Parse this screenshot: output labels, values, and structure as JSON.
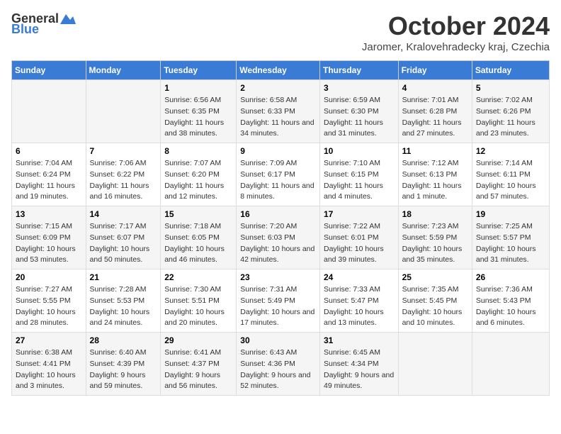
{
  "header": {
    "logo_general": "General",
    "logo_blue": "Blue",
    "month_title": "October 2024",
    "location": "Jaromer, Kralovehradecky kraj, Czechia"
  },
  "days_of_week": [
    "Sunday",
    "Monday",
    "Tuesday",
    "Wednesday",
    "Thursday",
    "Friday",
    "Saturday"
  ],
  "weeks": [
    [
      {
        "day": "",
        "info": ""
      },
      {
        "day": "",
        "info": ""
      },
      {
        "day": "1",
        "info": "Sunrise: 6:56 AM\nSunset: 6:35 PM\nDaylight: 11 hours and 38 minutes."
      },
      {
        "day": "2",
        "info": "Sunrise: 6:58 AM\nSunset: 6:33 PM\nDaylight: 11 hours and 34 minutes."
      },
      {
        "day": "3",
        "info": "Sunrise: 6:59 AM\nSunset: 6:30 PM\nDaylight: 11 hours and 31 minutes."
      },
      {
        "day": "4",
        "info": "Sunrise: 7:01 AM\nSunset: 6:28 PM\nDaylight: 11 hours and 27 minutes."
      },
      {
        "day": "5",
        "info": "Sunrise: 7:02 AM\nSunset: 6:26 PM\nDaylight: 11 hours and 23 minutes."
      }
    ],
    [
      {
        "day": "6",
        "info": "Sunrise: 7:04 AM\nSunset: 6:24 PM\nDaylight: 11 hours and 19 minutes."
      },
      {
        "day": "7",
        "info": "Sunrise: 7:06 AM\nSunset: 6:22 PM\nDaylight: 11 hours and 16 minutes."
      },
      {
        "day": "8",
        "info": "Sunrise: 7:07 AM\nSunset: 6:20 PM\nDaylight: 11 hours and 12 minutes."
      },
      {
        "day": "9",
        "info": "Sunrise: 7:09 AM\nSunset: 6:17 PM\nDaylight: 11 hours and 8 minutes."
      },
      {
        "day": "10",
        "info": "Sunrise: 7:10 AM\nSunset: 6:15 PM\nDaylight: 11 hours and 4 minutes."
      },
      {
        "day": "11",
        "info": "Sunrise: 7:12 AM\nSunset: 6:13 PM\nDaylight: 11 hours and 1 minute."
      },
      {
        "day": "12",
        "info": "Sunrise: 7:14 AM\nSunset: 6:11 PM\nDaylight: 10 hours and 57 minutes."
      }
    ],
    [
      {
        "day": "13",
        "info": "Sunrise: 7:15 AM\nSunset: 6:09 PM\nDaylight: 10 hours and 53 minutes."
      },
      {
        "day": "14",
        "info": "Sunrise: 7:17 AM\nSunset: 6:07 PM\nDaylight: 10 hours and 50 minutes."
      },
      {
        "day": "15",
        "info": "Sunrise: 7:18 AM\nSunset: 6:05 PM\nDaylight: 10 hours and 46 minutes."
      },
      {
        "day": "16",
        "info": "Sunrise: 7:20 AM\nSunset: 6:03 PM\nDaylight: 10 hours and 42 minutes."
      },
      {
        "day": "17",
        "info": "Sunrise: 7:22 AM\nSunset: 6:01 PM\nDaylight: 10 hours and 39 minutes."
      },
      {
        "day": "18",
        "info": "Sunrise: 7:23 AM\nSunset: 5:59 PM\nDaylight: 10 hours and 35 minutes."
      },
      {
        "day": "19",
        "info": "Sunrise: 7:25 AM\nSunset: 5:57 PM\nDaylight: 10 hours and 31 minutes."
      }
    ],
    [
      {
        "day": "20",
        "info": "Sunrise: 7:27 AM\nSunset: 5:55 PM\nDaylight: 10 hours and 28 minutes."
      },
      {
        "day": "21",
        "info": "Sunrise: 7:28 AM\nSunset: 5:53 PM\nDaylight: 10 hours and 24 minutes."
      },
      {
        "day": "22",
        "info": "Sunrise: 7:30 AM\nSunset: 5:51 PM\nDaylight: 10 hours and 20 minutes."
      },
      {
        "day": "23",
        "info": "Sunrise: 7:31 AM\nSunset: 5:49 PM\nDaylight: 10 hours and 17 minutes."
      },
      {
        "day": "24",
        "info": "Sunrise: 7:33 AM\nSunset: 5:47 PM\nDaylight: 10 hours and 13 minutes."
      },
      {
        "day": "25",
        "info": "Sunrise: 7:35 AM\nSunset: 5:45 PM\nDaylight: 10 hours and 10 minutes."
      },
      {
        "day": "26",
        "info": "Sunrise: 7:36 AM\nSunset: 5:43 PM\nDaylight: 10 hours and 6 minutes."
      }
    ],
    [
      {
        "day": "27",
        "info": "Sunrise: 6:38 AM\nSunset: 4:41 PM\nDaylight: 10 hours and 3 minutes."
      },
      {
        "day": "28",
        "info": "Sunrise: 6:40 AM\nSunset: 4:39 PM\nDaylight: 9 hours and 59 minutes."
      },
      {
        "day": "29",
        "info": "Sunrise: 6:41 AM\nSunset: 4:37 PM\nDaylight: 9 hours and 56 minutes."
      },
      {
        "day": "30",
        "info": "Sunrise: 6:43 AM\nSunset: 4:36 PM\nDaylight: 9 hours and 52 minutes."
      },
      {
        "day": "31",
        "info": "Sunrise: 6:45 AM\nSunset: 4:34 PM\nDaylight: 9 hours and 49 minutes."
      },
      {
        "day": "",
        "info": ""
      },
      {
        "day": "",
        "info": ""
      }
    ]
  ]
}
